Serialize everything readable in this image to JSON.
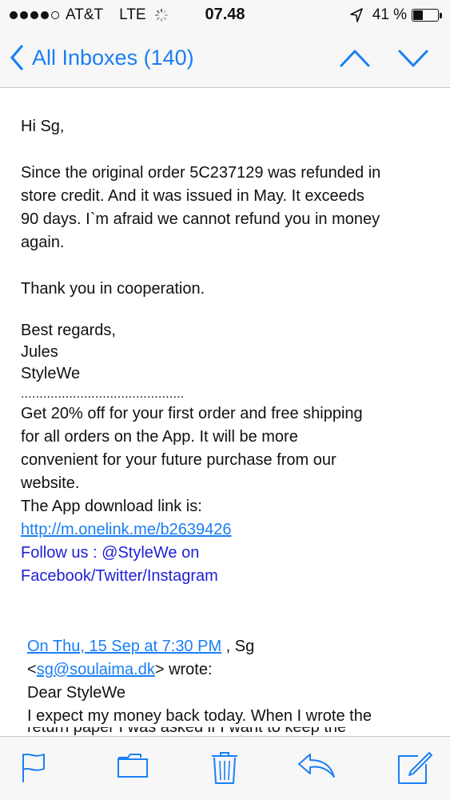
{
  "status_bar": {
    "carrier": "AT&T",
    "network": "LTE",
    "time": "07.48",
    "battery_pct": "41 %",
    "battery_level": 0.41
  },
  "nav": {
    "back_label": "All Inboxes (140)",
    "accent_color": "#1a7ff5"
  },
  "mail": {
    "greeting": "Hi Sg,",
    "paragraph1": "Since the original order 5C237129 was refunded in\nstore credit. And it was issued in May. It exceeds\n90 days. I`m afraid we cannot refund you in money\nagain.",
    "thanks": "Thank you in cooperation.",
    "regards": "Best regards,",
    "signer": "Jules",
    "company": "StyleWe",
    "divider": "............................................",
    "promo": "Get 20% off for your first order and free shipping\nfor all orders on the  App. It will be more\nconvenient for your future purchase from our\nwebsite.",
    "download_label": "The App download link is:",
    "download_link": "http://m.onelink.me/b2639426",
    "follow": "Follow us : @StyleWe on\nFacebook/Twitter/Instagram"
  },
  "quoted": {
    "date_link": "On Thu, 15 Sep at 7:30 PM",
    "sender_name": " , Sg",
    "email_prefix": "<",
    "email_link": "sg@soulaima.dk",
    "email_suffix": "> wrote:",
    "greeting": "Dear StyleWe",
    "line1": "I expect my money back today. When I wrote the",
    "line2_cut": "return  paper I was asked  if I want to keep the"
  },
  "toolbar": {
    "icons": [
      "flag-icon",
      "folder-icon",
      "trash-icon",
      "reply-icon",
      "compose-icon"
    ]
  }
}
